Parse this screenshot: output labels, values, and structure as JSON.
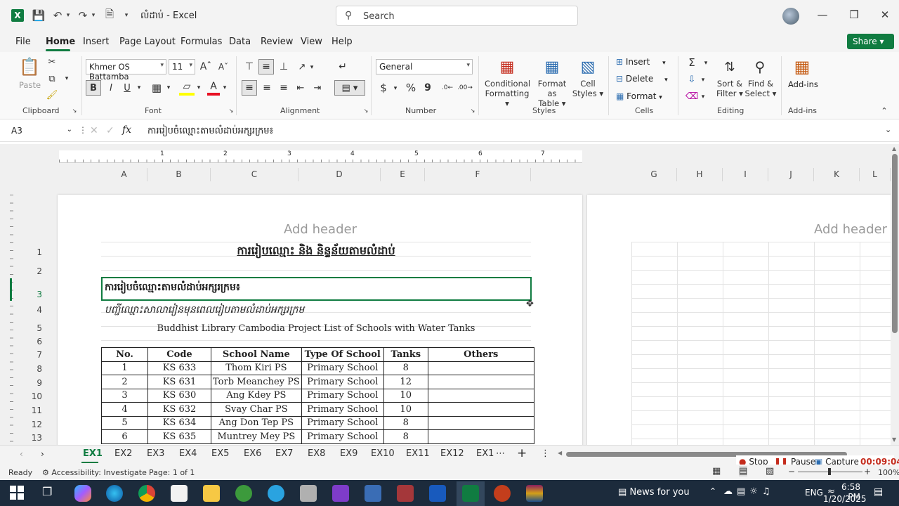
{
  "titlebar": {
    "doc_name": "លំដាប់",
    "app_name": "Excel",
    "search_placeholder": "Search"
  },
  "menu": {
    "items": [
      "File",
      "Home",
      "Insert",
      "Page Layout",
      "Formulas",
      "Data",
      "Review",
      "View",
      "Help"
    ],
    "share": "Share"
  },
  "ribbon": {
    "clipboard": {
      "paste": "Paste",
      "label": "Clipboard"
    },
    "font": {
      "name": "Khmer OS Battamba",
      "size": "11",
      "label": "Font",
      "bold": "B",
      "italic": "I",
      "underline": "U"
    },
    "alignment": {
      "label": "Alignment"
    },
    "number": {
      "format": "General",
      "label": "Number",
      "currency": "$",
      "percent": "%",
      "comma": "9"
    },
    "styles": {
      "conditional": "Conditional",
      "conditional2": "Formatting",
      "format_as": "Format as",
      "format_as2": "Table",
      "cell": "Cell",
      "cell2": "Styles",
      "label": "Styles"
    },
    "cells": {
      "insert": "Insert",
      "delete": "Delete",
      "format": "Format",
      "label": "Cells"
    },
    "editing": {
      "sort": "Sort &",
      "sort2": "Filter",
      "find": "Find &",
      "find2": "Select",
      "label": "Editing"
    },
    "addins": {
      "name": "Add-ins",
      "label": "Add-ins"
    }
  },
  "formula_bar": {
    "name_box": "A3",
    "fx": "fx",
    "content": "ការរៀបចំឈ្មោះតាមលំដាប់អក្សរក្រម៖"
  },
  "ruler_ticks": [
    "1",
    "2",
    "3",
    "4",
    "5",
    "6",
    "7"
  ],
  "columns_left": [
    "A",
    "B",
    "C",
    "D",
    "E",
    "F"
  ],
  "columns_right": [
    "G",
    "H",
    "I",
    "J",
    "K",
    "L"
  ],
  "add_header": "Add header",
  "rows": [
    "1",
    "2",
    "3",
    "4",
    "5",
    "6",
    "7",
    "8",
    "9",
    "10",
    "11",
    "12",
    "13"
  ],
  "cells": {
    "r1": "ការរៀបឈ្មោះ និង និន្ទន័យតាមលំដាប់",
    "r3": "ការរៀបចំឈ្មោះតាមលំដាប់អក្សរក្រម៖",
    "r4": "បញ្ជីឈ្មោះសាលារៀនមុនពេលរៀបតាមលំដាប់អក្សរក្រម",
    "r5": "Buddhist Library Cambodia Project List of Schools with Water Tanks"
  },
  "table": {
    "headers": [
      "No.",
      "Code",
      "School Name",
      "Type Of School",
      "Tanks",
      "Others"
    ],
    "rows": [
      [
        "1",
        "KS 633",
        "Thom Kiri PS",
        "Primary School",
        "8",
        ""
      ],
      [
        "2",
        "KS 631",
        "Torb Meanchey PS",
        "Primary School",
        "12",
        ""
      ],
      [
        "3",
        "KS 630",
        "Ang Kdey PS",
        "Primary School",
        "10",
        ""
      ],
      [
        "4",
        "KS 632",
        "Svay Char PS",
        "Primary School",
        "10",
        ""
      ],
      [
        "5",
        "KS 634",
        "Ang Don Tep PS",
        "Primary School",
        "8",
        ""
      ],
      [
        "6",
        "KS 635",
        "Muntrey Mey PS",
        "Primary School",
        "8",
        ""
      ]
    ]
  },
  "sheet_tabs": [
    "EX1",
    "EX2",
    "EX3",
    "EX4",
    "EX5",
    "EX6",
    "EX7",
    "EX8",
    "EX9",
    "EX10",
    "EX11",
    "EX12",
    "EX1"
  ],
  "status": {
    "ready": "Ready",
    "accessibility": "Accessibility: Investigate",
    "page": "Page: 1 of 1",
    "zoom": "100%"
  },
  "recorder": {
    "stop": "Stop",
    "pause": "Pause",
    "capture": "Capture",
    "time": "00:09:04"
  },
  "taskbar": {
    "news": "News for you",
    "lang": "ENG",
    "time": "6:58 PM",
    "date": "1/20/2025"
  },
  "colors": {
    "excel_green": "#107c41",
    "taskbar": "#1c2b3c",
    "record_red": "#c42b1c"
  }
}
